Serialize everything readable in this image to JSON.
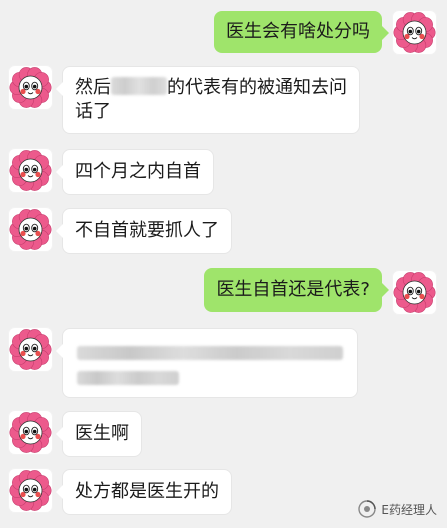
{
  "colors": {
    "background": "#f0f0f0",
    "bubble_in": "#ffffff",
    "bubble_out": "#9fe46b",
    "avatar_petal": "#ec5a8c",
    "avatar_face": "#ffffff"
  },
  "avatar_icon": "pink-flower-face-icon",
  "messages": [
    {
      "side": "out",
      "text": "医生会有啥处分吗"
    },
    {
      "side": "in",
      "line1_before": "然后",
      "line1_after": "的代表有的被通知去问",
      "line2": "话了",
      "redacted": true
    },
    {
      "side": "in",
      "text": "四个月之内自首"
    },
    {
      "side": "in",
      "text": "不自首就要抓人了"
    },
    {
      "side": "out",
      "text": "医生自首还是代表?"
    },
    {
      "side": "in",
      "redacted_only": true
    },
    {
      "side": "in",
      "text": "医生啊"
    },
    {
      "side": "in",
      "text": "处方都是医生开的"
    }
  ],
  "watermark": {
    "icon": "wechat-official-account-icon",
    "label": "E药经理人"
  }
}
